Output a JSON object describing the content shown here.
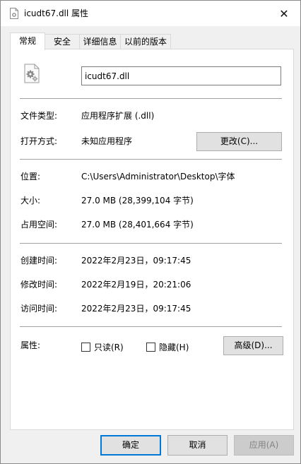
{
  "window": {
    "title": "icudt67.dll 属性",
    "close_glyph": "✕"
  },
  "tabs": [
    {
      "label": "常规",
      "active": true
    },
    {
      "label": "安全",
      "active": false
    },
    {
      "label": "详细信息",
      "active": false
    },
    {
      "label": "以前的版本",
      "active": false
    }
  ],
  "general": {
    "file_name": "icudt67.dll",
    "file_type_label": "文件类型:",
    "file_type_value": "应用程序扩展 (.dll)",
    "opens_with_label": "打开方式:",
    "opens_with_value": "未知应用程序",
    "change_button": "更改(C)...",
    "location_label": "位置:",
    "location_value": "C:\\Users\\Administrator\\Desktop\\字体",
    "size_label": "大小:",
    "size_value": "27.0 MB (28,399,104 字节)",
    "size_on_disk_label": "占用空间:",
    "size_on_disk_value": "27.0 MB (28,401,664 字节)",
    "created_label": "创建时间:",
    "created_value": "2022年2月23日，09:17:45",
    "modified_label": "修改时间:",
    "modified_value": "2022年2月19日，20:21:06",
    "accessed_label": "访问时间:",
    "accessed_value": "2022年2月23日，09:17:45",
    "attributes_label": "属性:",
    "readonly_label": "只读(R)",
    "readonly_checked": false,
    "hidden_label": "隐藏(H)",
    "hidden_checked": false,
    "advanced_button": "高级(D)..."
  },
  "footer": {
    "ok_button": "确定",
    "cancel_button": "取消",
    "apply_button": "应用(A)"
  },
  "colors": {
    "accent": "#0078d7",
    "panel_bg": "#ffffff",
    "window_bg": "#f0f0f0"
  }
}
